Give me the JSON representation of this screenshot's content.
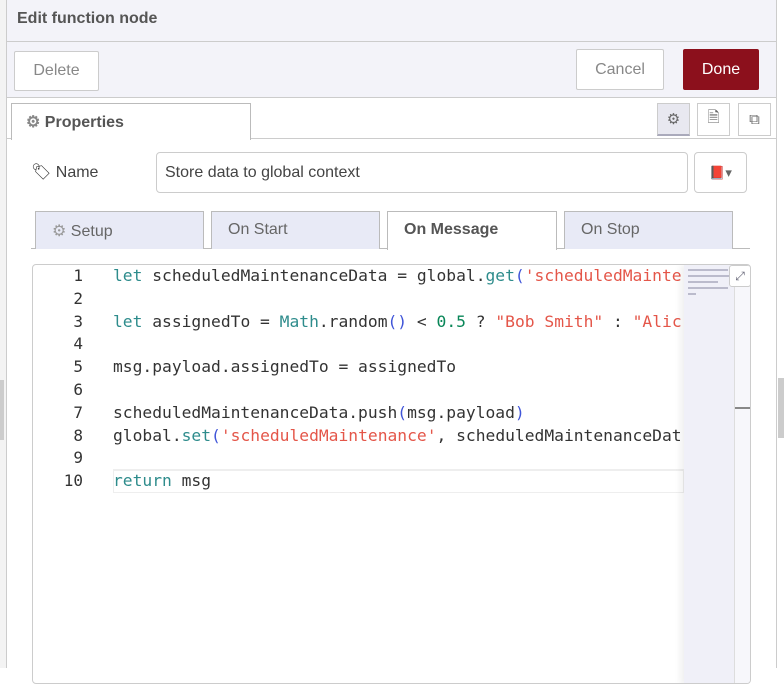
{
  "header": {
    "title": "Edit function node"
  },
  "actions": {
    "delete_label": "Delete",
    "cancel_label": "Cancel",
    "done_label": "Done",
    "done_color": "#8c101c"
  },
  "tabs": {
    "properties_label": "Properties",
    "icons": [
      "gear-icon",
      "document-icon",
      "frame-icon"
    ]
  },
  "name_field": {
    "label": "Name",
    "value": "Store data to global context"
  },
  "subtabs": [
    {
      "label": "Setup",
      "active": false
    },
    {
      "label": "On Start",
      "active": false
    },
    {
      "label": "On Message",
      "active": true
    },
    {
      "label": "On Stop",
      "active": false
    }
  ],
  "editor": {
    "lines": [
      {
        "n": "1",
        "tokens": [
          [
            "kw",
            "let"
          ],
          [
            "plain",
            " scheduledMaintenanceData = global."
          ],
          [
            "fn",
            "get"
          ],
          [
            "br",
            "("
          ],
          [
            "str",
            "'scheduledMainte"
          ]
        ]
      },
      {
        "n": "2",
        "tokens": []
      },
      {
        "n": "3",
        "tokens": [
          [
            "kw",
            "let"
          ],
          [
            "plain",
            " assignedTo = "
          ],
          [
            "builtin",
            "Math"
          ],
          [
            "plain",
            ".random"
          ],
          [
            "br",
            "()"
          ],
          [
            "plain",
            " < "
          ],
          [
            "num",
            "0.5"
          ],
          [
            "plain",
            " ? "
          ],
          [
            "str",
            "\"Bob Smith\""
          ],
          [
            "plain",
            " : "
          ],
          [
            "str",
            "\"Alic"
          ]
        ]
      },
      {
        "n": "4",
        "tokens": []
      },
      {
        "n": "5",
        "tokens": [
          [
            "plain",
            "msg.payload.assignedTo = assignedTo"
          ]
        ]
      },
      {
        "n": "6",
        "tokens": []
      },
      {
        "n": "7",
        "tokens": [
          [
            "plain",
            "scheduledMaintenanceData.push"
          ],
          [
            "br",
            "("
          ],
          [
            "plain",
            "msg.payload"
          ],
          [
            "br",
            ")"
          ]
        ]
      },
      {
        "n": "8",
        "tokens": [
          [
            "plain",
            "global."
          ],
          [
            "fn",
            "set"
          ],
          [
            "br",
            "("
          ],
          [
            "str",
            "'scheduledMaintenance'"
          ],
          [
            "plain",
            ", scheduledMaintenanceDat"
          ]
        ]
      },
      {
        "n": "9",
        "tokens": []
      },
      {
        "n": "10",
        "tokens": [
          [
            "kw",
            "return"
          ],
          [
            "plain",
            " msg"
          ]
        ]
      }
    ],
    "current_line": 10
  }
}
